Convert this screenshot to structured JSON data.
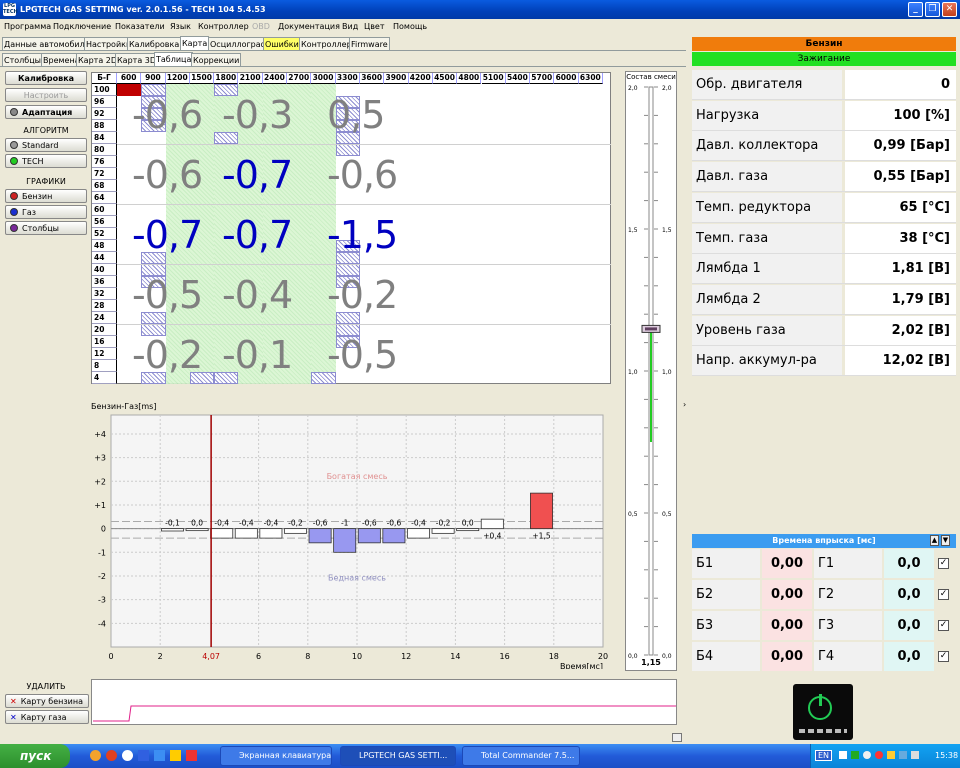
{
  "window": {
    "title": "LPGTECH GAS SETTING ver. 2.0.1.56  -  TECH 104  5.4.53",
    "logo_text": "LPG TECH"
  },
  "menu": [
    {
      "label": "Программа",
      "disabled": false
    },
    {
      "label": "Подключение",
      "disabled": false
    },
    {
      "label": "Показатели",
      "disabled": false
    },
    {
      "label": "Язык",
      "disabled": false
    },
    {
      "label": "Контроллер",
      "disabled": false
    },
    {
      "label": "OBD",
      "disabled": true
    },
    {
      "label": "Документация",
      "disabled": false
    },
    {
      "label": "Вид",
      "disabled": false
    },
    {
      "label": "Цвет",
      "disabled": false
    },
    {
      "label": "Помощь",
      "disabled": false
    }
  ],
  "main_tabs": [
    "Данные автомобиля",
    "Настройки",
    "Калибровка",
    "Карта",
    "Осциллограф",
    "Ошибки",
    "Контроллер",
    "Firmware"
  ],
  "main_tab_active": "Карта",
  "sub_tabs": [
    "Столбцы",
    "Времена",
    "Карта 2D",
    "Карта 3D",
    "Таблица",
    "Коррекции"
  ],
  "sub_tab_active": "Таблица",
  "left": {
    "calibration": "Калибровка",
    "adjust": "Настроить",
    "adaptation": "Адаптация",
    "algorithm_title": "АЛГОРИТМ",
    "algorithms": [
      "Standard",
      "TECH"
    ],
    "graphs_title": "ГРАФИКИ",
    "graphs": [
      "Бензин",
      "Газ",
      "Столбцы"
    ],
    "delete_title": "УДАЛИТЬ",
    "delete_buttons": [
      "Карту бензина",
      "Карту газа"
    ]
  },
  "grid": {
    "corner": "Б-Г",
    "rpm": [
      "600",
      "900",
      "1200",
      "1500",
      "1800",
      "2100",
      "2400",
      "2700",
      "3000",
      "3300",
      "3600",
      "3900",
      "4200",
      "4500",
      "4800",
      "5100",
      "5400",
      "5700",
      "6000",
      "6300"
    ],
    "rows": [
      "100",
      "96",
      "92",
      "88",
      "84",
      "80",
      "76",
      "72",
      "68",
      "64",
      "60",
      "56",
      "52",
      "48",
      "44",
      "40",
      "36",
      "32",
      "28",
      "24",
      "20",
      "16",
      "12",
      "8",
      "4"
    ],
    "big_values": [
      [
        "-0,6",
        "-0,3",
        "0,5"
      ],
      [
        "-0,6",
        "-0,7",
        "-0,6"
      ],
      [
        "-0,7",
        "-0,7",
        "-1,5"
      ],
      [
        "-0,5",
        "-0,4",
        "-0,2"
      ],
      [
        "-0,2",
        "-0,1",
        "-0,5"
      ]
    ],
    "big_colors": [
      [
        "#808080",
        "#808080",
        "#808080"
      ],
      [
        "#808080",
        "#0000c0",
        "#808080"
      ],
      [
        "#0000c0",
        "#0000c0",
        "#0000c0"
      ],
      [
        "#808080",
        "#808080",
        "#808080"
      ],
      [
        "#808080",
        "#808080",
        "#808080"
      ]
    ]
  },
  "chart_data": {
    "type": "bar",
    "title": "Бензин-Газ[ms]",
    "xlabel": "Время[мс]",
    "x_ticks": [
      "0",
      "2",
      "4,07",
      "6",
      "8",
      "10",
      "12",
      "14",
      "16",
      "18",
      "20"
    ],
    "y_ticks": [
      "+4",
      "+3",
      "+2",
      "+1",
      "0",
      "-1",
      "-2",
      "-3",
      "-4"
    ],
    "xlim": [
      0,
      20
    ],
    "ylim": [
      -5,
      4.8
    ],
    "marker_x": 4.07,
    "rich_label": "Богатая смесь",
    "lean_label": "Бедная смесь",
    "bars": [
      {
        "x": 2.5,
        "value": -0.1,
        "label": "-0,1"
      },
      {
        "x": 3.5,
        "value": 0.0,
        "label": "0,0"
      },
      {
        "x": 4.5,
        "value": -0.4,
        "label": "-0,4"
      },
      {
        "x": 5.5,
        "value": -0.4,
        "label": "-0,4"
      },
      {
        "x": 6.5,
        "value": -0.4,
        "label": "-0,4"
      },
      {
        "x": 7.5,
        "value": -0.2,
        "label": "-0,2"
      },
      {
        "x": 8.5,
        "value": -0.6,
        "label": "-0,6"
      },
      {
        "x": 9.5,
        "value": -1.0,
        "label": "-1"
      },
      {
        "x": 10.5,
        "value": -0.6,
        "label": "-0,6"
      },
      {
        "x": 11.5,
        "value": -0.6,
        "label": "-0,6"
      },
      {
        "x": 12.5,
        "value": -0.4,
        "label": "-0,4"
      },
      {
        "x": 13.5,
        "value": -0.2,
        "label": "-0,2"
      },
      {
        "x": 14.5,
        "value": 0.0,
        "label": "0,0"
      },
      {
        "x": 15.5,
        "value": 0.4,
        "label": "+0,4"
      },
      {
        "x": 17.5,
        "value": 1.5,
        "label": "+1,5"
      }
    ]
  },
  "mixture": {
    "title": "Состав смеси",
    "ticks": [
      "2,0",
      "1,5",
      "1,0",
      "0,5",
      "0,0"
    ],
    "value": "1,15",
    "value_num": 1.15,
    "range": [
      0,
      2
    ]
  },
  "status": {
    "fuel": "Бензин",
    "mode": "Зажигание",
    "fuel_color": "#f07c0c",
    "mode_color": "#22e022"
  },
  "params": [
    {
      "label": "Обр. двигателя",
      "value": "0"
    },
    {
      "label": "Нагрузка",
      "value": "100 [%]"
    },
    {
      "label": "Давл. коллектора",
      "value": "0,99 [Бар]"
    },
    {
      "label": "Давл. газа",
      "value": "0,55 [Бар]"
    },
    {
      "label": "Темп. редуктора",
      "value": "65 [°C]"
    },
    {
      "label": "Темп. газа",
      "value": "38 [°C]"
    },
    {
      "label": "Лямбда 1",
      "value": "1,81 [В]"
    },
    {
      "label": "Лямбда 2",
      "value": "1,79 [В]"
    },
    {
      "label": "Уровень газа",
      "value": "2,02 [В]"
    },
    {
      "label": "Напр. аккумул-ра",
      "value": "12,02 [В]"
    }
  ],
  "injection": {
    "title": "Времена впрыска [мс]",
    "rows": [
      {
        "b": "Б1",
        "bv": "0,00",
        "g": "Г1",
        "gv": "0,0"
      },
      {
        "b": "Б2",
        "bv": "0,00",
        "g": "Г2",
        "gv": "0,0"
      },
      {
        "b": "Б3",
        "bv": "0,00",
        "g": "Г3",
        "gv": "0,0"
      },
      {
        "b": "Б4",
        "bv": "0,00",
        "g": "Г4",
        "gv": "0,0"
      }
    ]
  },
  "taskbar": {
    "start": "пуск",
    "tasks": [
      "Экранная клавиатура",
      "LPGTECH GAS SETTI...",
      "Total Commander 7.5..."
    ],
    "lang": "EN",
    "clock": "15:38"
  }
}
